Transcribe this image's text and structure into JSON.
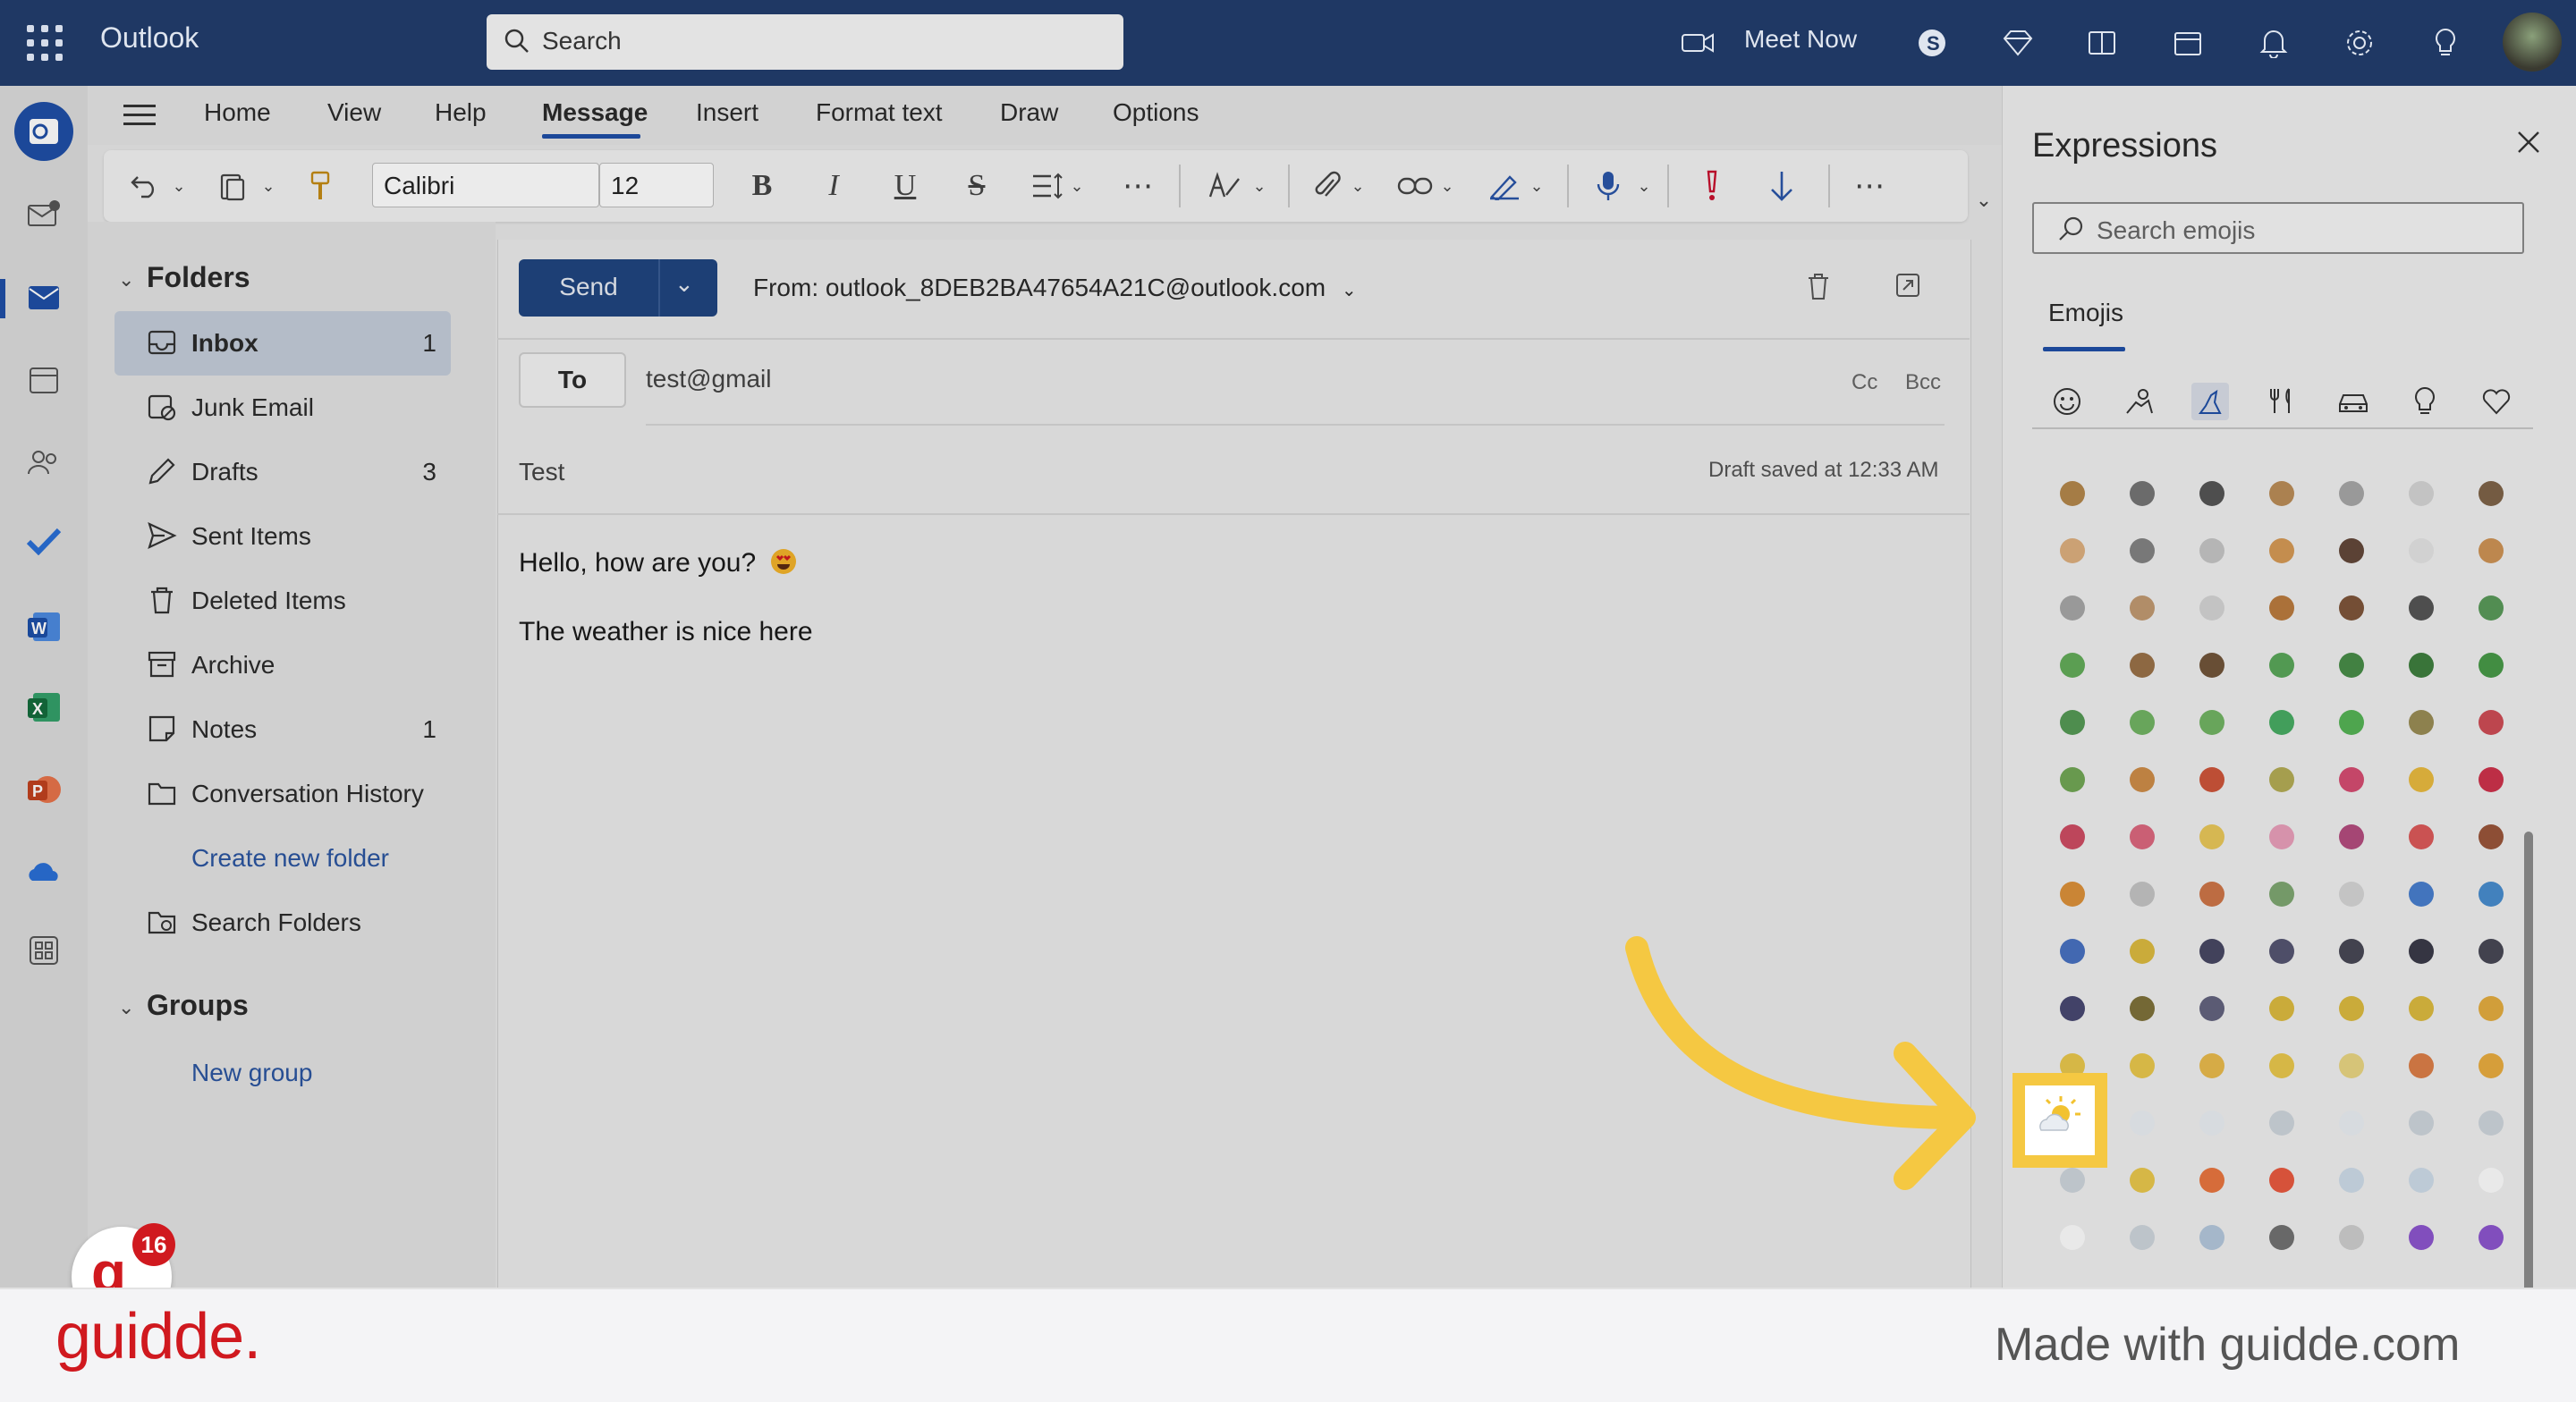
{
  "app": {
    "title": "Outlook"
  },
  "search": {
    "placeholder": "Search"
  },
  "topbar": {
    "meet_now": "Meet Now"
  },
  "ribbon": {
    "tabs": [
      "Home",
      "View",
      "Help",
      "Message",
      "Insert",
      "Format text",
      "Draw",
      "Options"
    ],
    "active_tab": "Message",
    "font_name": "Calibri",
    "font_size": "12"
  },
  "folders": {
    "header": "Folders",
    "items": [
      {
        "label": "Inbox",
        "count": "1"
      },
      {
        "label": "Junk Email",
        "count": ""
      },
      {
        "label": "Drafts",
        "count": "3"
      },
      {
        "label": "Sent Items",
        "count": ""
      },
      {
        "label": "Deleted Items",
        "count": ""
      },
      {
        "label": "Archive",
        "count": ""
      },
      {
        "label": "Notes",
        "count": "1"
      },
      {
        "label": "Conversation History",
        "count": ""
      }
    ],
    "create_new": "Create new folder",
    "search_folders": "Search Folders",
    "groups_header": "Groups",
    "new_group": "New group"
  },
  "compose": {
    "send_label": "Send",
    "from": "From: outlook_8DEB2BA47654A21C@outlook.com",
    "to_label": "To",
    "recipient": "test@gmail",
    "cc": "Cc",
    "bcc": "Bcc",
    "subject": "Test",
    "draft_status": "Draft saved at 12:33 AM",
    "body_line1": "Hello, how are you?",
    "body_line2": "The weather is nice here"
  },
  "expressions": {
    "title": "Expressions",
    "search_placeholder": "Search emojis",
    "tab": "Emojis",
    "categories": [
      "smiley-icon",
      "people-icon",
      "animals-nature-icon",
      "food-icon",
      "travel-icon",
      "objects-icon",
      "symbols-icon"
    ],
    "selected_category": "animals-nature-icon"
  },
  "notifications": {
    "badge_count": "16"
  },
  "footer": {
    "brand": "guidde.",
    "made_with": "Made with guidde.com"
  },
  "colors": {
    "accent": "#1f4fa6",
    "topbar": "#1f3864",
    "highlight": "#f5c842",
    "brand_red": "#d0191f"
  }
}
